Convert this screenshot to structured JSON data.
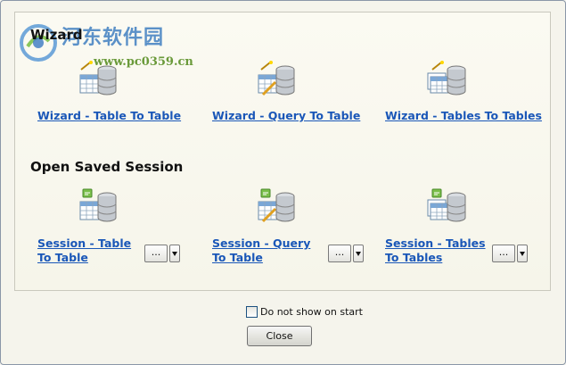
{
  "watermark": {
    "title": "河东软件园",
    "url": "www.pc0359.cn"
  },
  "wizard": {
    "title": "Wizard",
    "items": [
      {
        "label": "Wizard - Table To Table",
        "icon": "wizard-table-db-icon"
      },
      {
        "label": "Wizard - Query To Table",
        "icon": "wizard-query-db-icon"
      },
      {
        "label": "Wizard - Tables To Tables",
        "icon": "wizard-tables-db-icon"
      }
    ]
  },
  "session": {
    "title": "Open Saved Session",
    "items": [
      {
        "line1": "Session - Table",
        "line2": "To Table",
        "button": "...",
        "icon": "session-table-db-icon"
      },
      {
        "line1": "Session - Query",
        "line2": "To Table",
        "button": "...",
        "icon": "session-query-db-icon"
      },
      {
        "line1": "Session - Tables",
        "line2": "To Tables",
        "button": "...",
        "icon": "session-tables-db-icon"
      }
    ]
  },
  "footer": {
    "checkbox_label": "Do not show on start",
    "checkbox_checked": false,
    "close_label": "Close"
  },
  "colors": {
    "link": "#1a57b8",
    "background": "#f5f4ec",
    "border": "#c9c8bd"
  }
}
